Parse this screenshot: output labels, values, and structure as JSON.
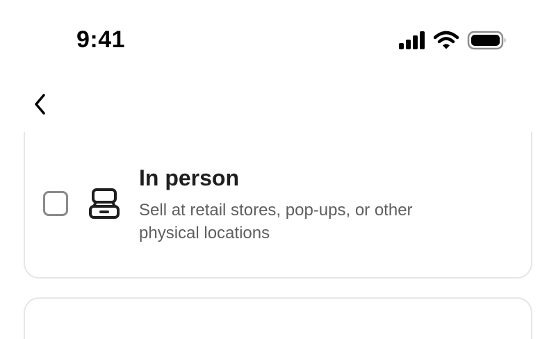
{
  "status_bar": {
    "time": "9:41",
    "icons": [
      "cellular-signal-icon",
      "wifi-icon",
      "battery-icon"
    ]
  },
  "nav": {
    "back_icon": "chevron-left-icon"
  },
  "options": [
    {
      "title": "In person",
      "description": "Sell at retail stores, pop-ups, or other physical locations",
      "icon": "point-of-sale-icon",
      "checked": false
    }
  ],
  "colors": {
    "background": "#ffffff",
    "card_border": "#e6e6e6",
    "checkbox_border": "#8a8a8a",
    "title": "#1f1f1f",
    "description": "#5f5f5f"
  }
}
